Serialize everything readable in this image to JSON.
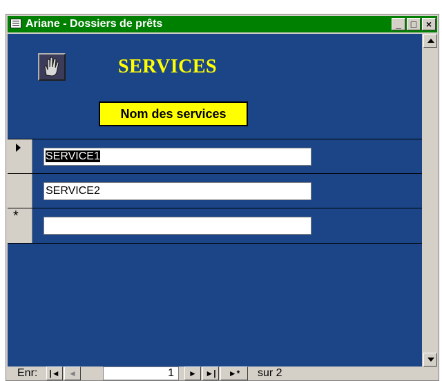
{
  "window": {
    "title": "Ariane - Dossiers de prêts",
    "minimize": "_",
    "maximize": "□",
    "close": "×"
  },
  "form": {
    "title": "SERVICES",
    "column_header": "Nom des services",
    "rows": [
      {
        "value": "SERVICE1",
        "selected": true
      },
      {
        "value": "SERVICE2",
        "selected": false
      },
      {
        "value": "",
        "new_record": true
      }
    ],
    "colors": {
      "background": "#1c4587",
      "title": "#ffff00",
      "header_bg": "#ffff00",
      "titlebar": "#008000"
    }
  },
  "navigation": {
    "label": "Enr:",
    "first": "|◄",
    "prev": "◄",
    "current": "1",
    "next": "►",
    "last": "►|",
    "new": "►*",
    "total": "sur  2"
  }
}
